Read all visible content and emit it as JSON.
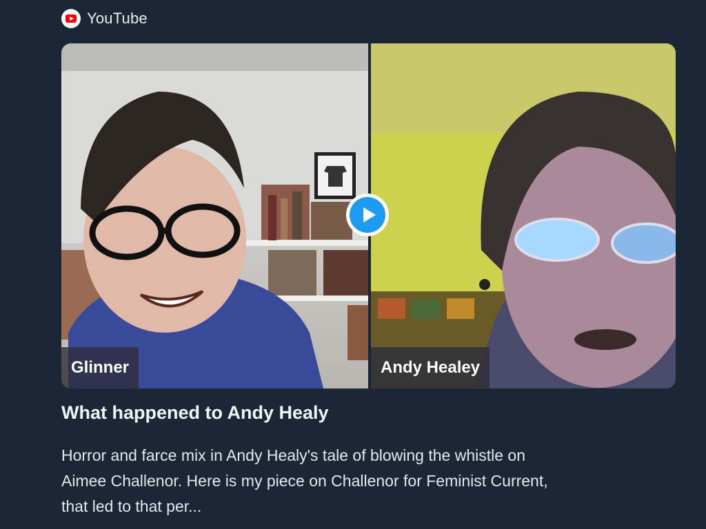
{
  "source": {
    "icon": "youtube-icon",
    "label": "YouTube"
  },
  "video": {
    "play_icon": "play-icon",
    "participants": [
      {
        "name": "Glinner"
      },
      {
        "name": "Andy Healey"
      }
    ]
  },
  "card": {
    "title": "What happened to Andy Healy",
    "description_lines": [
      "Horror and farce mix in Andy Healy's tale of blowing the whistle on",
      "Aimee Challenor. Here is my piece on Challenor for Feminist Current,",
      "that led to that per..."
    ]
  },
  "colors": {
    "background": "#1b2735",
    "play_button": "#1d9bf0",
    "youtube_red": "#ff0000"
  }
}
